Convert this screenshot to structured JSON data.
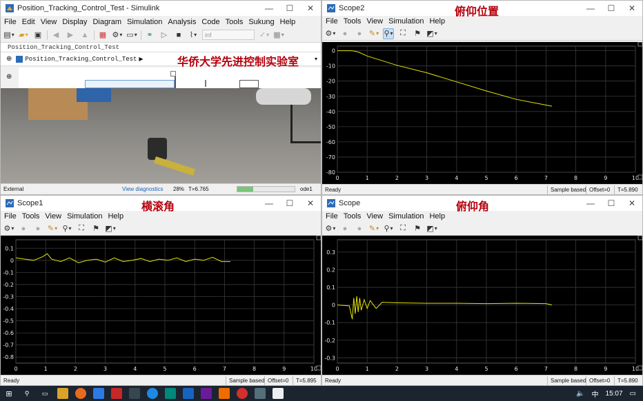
{
  "simulink": {
    "title": "Position_Tracking_Control_Test - Simulink",
    "menu": [
      "File",
      "Edit",
      "View",
      "Display",
      "Diagram",
      "Simulation",
      "Analysis",
      "Code",
      "Tools",
      "Sukung",
      "Help"
    ],
    "stop_time_value": "inf",
    "model_tab": "Position_Tracking_Control_Test",
    "breadcrumb": "Position_Tracking_Control_Test",
    "lab_label": "华侨大学先进控制实验室",
    "status_left": "External",
    "view_diagnostics": "View diagnostics",
    "progress_text": "28%",
    "progress_fraction": 0.28,
    "time_text": "T=6.765",
    "solver": "ode1"
  },
  "scopes": [
    {
      "id": "scope2",
      "title": "Scope2",
      "cn_label": "俯仰位置",
      "menu": [
        "File",
        "Tools",
        "View",
        "Simulation",
        "Help"
      ],
      "status": "Ready",
      "sample": "Sample based",
      "offset": "Offset=0",
      "time": "T=5.890",
      "yticks": [
        "0",
        "-10",
        "-20",
        "-30",
        "-40",
        "-50",
        "-60",
        "-70",
        "-80"
      ],
      "xticks": [
        "0",
        "1",
        "2",
        "3",
        "4",
        "5",
        "6",
        "7",
        "8",
        "9",
        "10"
      ]
    },
    {
      "id": "scope1",
      "title": "Scope1",
      "cn_label": "横滚角",
      "menu": [
        "File",
        "Tools",
        "View",
        "Simulation",
        "Help"
      ],
      "status": "Ready",
      "sample": "Sample based",
      "offset": "Offset=0",
      "time": "T=5.895",
      "yticks": [
        "0.1",
        "0",
        "-0.1",
        "-0.2",
        "-0.3",
        "-0.4",
        "-0.5",
        "-0.6",
        "-0.7",
        "-0.8"
      ],
      "xticks": [
        "0",
        "1",
        "2",
        "3",
        "4",
        "5",
        "6",
        "7",
        "8",
        "9",
        "10"
      ]
    },
    {
      "id": "scope",
      "title": "Scope",
      "cn_label": "俯仰角",
      "menu": [
        "File",
        "Tools",
        "View",
        "Simulation",
        "Help"
      ],
      "status": "Ready",
      "sample": "Sample based",
      "offset": "Offset=0",
      "time": "T=5.890",
      "yticks": [
        "0.3",
        "0.2",
        "0.1",
        "0",
        "-0.1",
        "-0.2",
        "-0.3"
      ],
      "xticks": [
        "0",
        "1",
        "2",
        "3",
        "4",
        "5",
        "6",
        "7",
        "8",
        "9",
        "10"
      ]
    }
  ],
  "chart_data": [
    {
      "type": "line",
      "series": [
        {
          "x": [
            0,
            0.5,
            0.7,
            1.0,
            2.0,
            3.0,
            4.0,
            5.0,
            6.0,
            7.2
          ],
          "y": [
            0,
            0,
            -0.8,
            -3.5,
            -9.6,
            -14.5,
            -20.5,
            -26.5,
            -32,
            -36.5
          ]
        }
      ],
      "xlim": [
        0,
        10
      ],
      "ylim": [
        -80,
        3
      ],
      "color": "#e6e600",
      "grid": true
    },
    {
      "type": "line",
      "series": [
        {
          "x": [
            0,
            0.3,
            0.6,
            0.9,
            1.05,
            1.2,
            1.5,
            1.8,
            2.1,
            2.4,
            2.7,
            3.0,
            3.3,
            3.6,
            3.9,
            4.2,
            4.5,
            4.8,
            5.1,
            5.4,
            5.7,
            6.0,
            6.3,
            6.6,
            6.9,
            7.2
          ],
          "y": [
            0.02,
            0.01,
            0.0,
            0.03,
            0.055,
            0.01,
            -0.01,
            0.02,
            -0.02,
            0.0,
            0.01,
            -0.015,
            0.02,
            -0.01,
            0.0,
            0.015,
            -0.01,
            0.01,
            0.0,
            0.02,
            -0.01,
            0.01,
            0.0,
            0.025,
            -0.01,
            -0.01
          ]
        }
      ],
      "xlim": [
        0,
        10
      ],
      "ylim": [
        -0.85,
        0.17
      ],
      "color": "#e6e600",
      "grid": true
    },
    {
      "type": "line",
      "series": [
        {
          "x": [
            0,
            0.4,
            0.5,
            0.55,
            0.6,
            0.65,
            0.7,
            0.75,
            0.8,
            0.9,
            1.0,
            1.1,
            1.3,
            1.5,
            2.0,
            3.0,
            4.0,
            5.0,
            6.0,
            7.0,
            7.2
          ],
          "y": [
            0,
            -0.005,
            -0.08,
            0.04,
            -0.05,
            0.05,
            -0.04,
            0.04,
            -0.03,
            0.03,
            -0.02,
            0.025,
            -0.02,
            0.015,
            0.012,
            0.01,
            0.01,
            0.008,
            0.01,
            0.008,
            0.0
          ]
        }
      ],
      "xlim": [
        0,
        10
      ],
      "ylim": [
        -0.33,
        0.37
      ],
      "color": "#e6e600",
      "grid": true
    }
  ],
  "taskbar": {
    "time": "15:07",
    "ime": "中"
  }
}
